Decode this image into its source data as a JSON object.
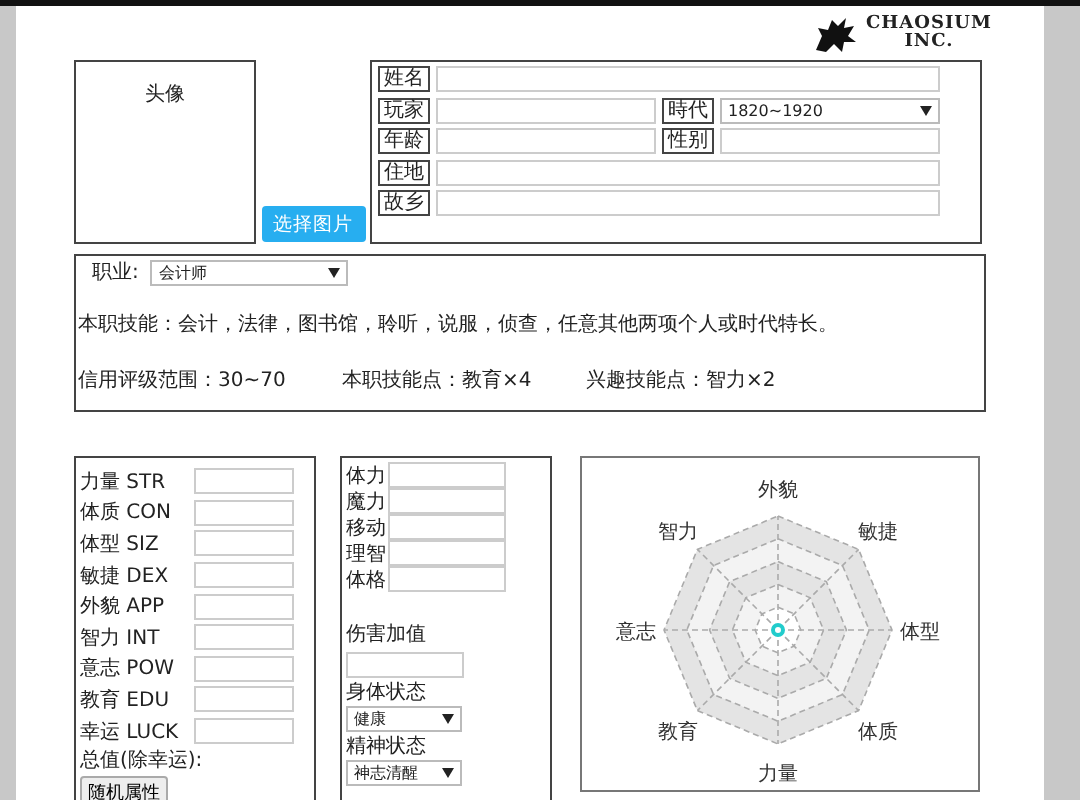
{
  "logo": {
    "line1": "CHAOSIUM",
    "line2": "INC."
  },
  "portrait": {
    "label": "头像",
    "button": "选择图片"
  },
  "identity": [
    [
      {
        "label": "姓名",
        "kind": "input"
      }
    ],
    [
      {
        "label": "玩家",
        "kind": "input"
      },
      {
        "label": "時代",
        "kind": "select",
        "value": "1820~1920"
      }
    ],
    [
      {
        "label": "年龄",
        "kind": "input"
      },
      {
        "label": "性别",
        "kind": "input"
      }
    ],
    [
      {
        "label": "住地",
        "kind": "input"
      }
    ],
    [
      {
        "label": "故乡",
        "kind": "input"
      }
    ]
  ],
  "occupation": {
    "label": "职业:",
    "value": "会计师",
    "skills": "本职技能：会计，法律，图书馆，聆听，说服，侦查，任意其他两项个人或时代特长。",
    "facts": [
      "信用评级范围：30~70",
      "本职技能点：教育×4",
      "兴趣技能点：智力×2"
    ]
  },
  "attributes": [
    "力量 STR",
    "体质 CON",
    "体型 SIZ",
    "敏捷 DEX",
    "外貌 APP",
    "智力 INT",
    "意志 POW",
    "教育 EDU",
    "幸运 LUCK"
  ],
  "total_label": "总值(除幸运):",
  "random_button": "随机属性",
  "derived": [
    "体力",
    "魔力",
    "移动",
    "理智",
    "体格"
  ],
  "damage_bonus": "伤害加值",
  "statuses": [
    {
      "label": "身体状态",
      "value": "健康"
    },
    {
      "label": "精神状态",
      "value": "神志清醒"
    }
  ],
  "radar": {
    "axes": [
      "外貌",
      "敏捷",
      "体型",
      "体质",
      "力量",
      "教育",
      "意志",
      "智力"
    ]
  }
}
